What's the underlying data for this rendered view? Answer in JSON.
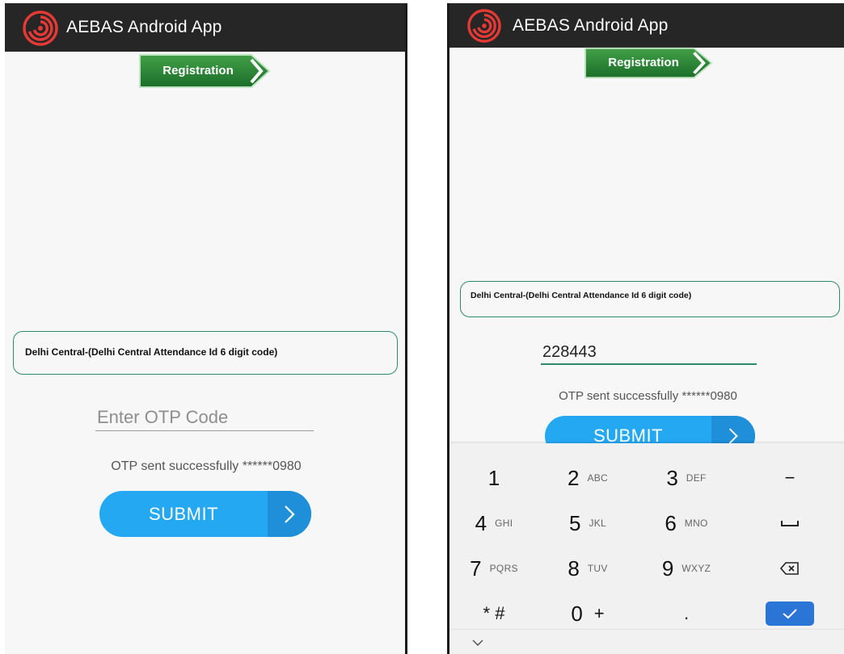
{
  "app": {
    "title": "AEBAS Android App",
    "logo_icon": "fingerprint-logo-icon",
    "accent": "#e53935"
  },
  "registration_badge": {
    "label": "Registration",
    "color": "#2e8b3a"
  },
  "attendance_box": {
    "text": "Delhi Central-(Delhi Central Attendance Id 6 digit code)"
  },
  "left_screen": {
    "otp_input": {
      "placeholder": "Enter OTP Code",
      "value": ""
    },
    "status": "OTP sent successfully ******0980",
    "submit_label": "SUBMIT"
  },
  "right_screen": {
    "otp_input": {
      "placeholder": "Enter OTP Code",
      "value": "228443"
    },
    "status": "OTP sent successfully ******0980",
    "submit_label": "SUBMIT"
  },
  "keyboard": {
    "keys": [
      {
        "main": "1",
        "sub": ""
      },
      {
        "main": "2",
        "sub": "ABC"
      },
      {
        "main": "3",
        "sub": "DEF"
      },
      {
        "main": "−",
        "sub": ""
      },
      {
        "main": "4",
        "sub": "GHI"
      },
      {
        "main": "5",
        "sub": "JKL"
      },
      {
        "main": "6",
        "sub": "MNO"
      },
      {
        "main": "",
        "sub": "",
        "icon": "space-icon"
      },
      {
        "main": "7",
        "sub": "PQRS"
      },
      {
        "main": "8",
        "sub": "TUV"
      },
      {
        "main": "9",
        "sub": "WXYZ"
      },
      {
        "main": "",
        "sub": "",
        "icon": "backspace-icon"
      },
      {
        "main": "* #",
        "sub": ""
      },
      {
        "main": "0",
        "sub": "+"
      },
      {
        "main": ".",
        "sub": ""
      },
      {
        "main": "",
        "sub": "",
        "icon": "done-check-icon"
      }
    ],
    "enter_color": "#2b75d6"
  }
}
